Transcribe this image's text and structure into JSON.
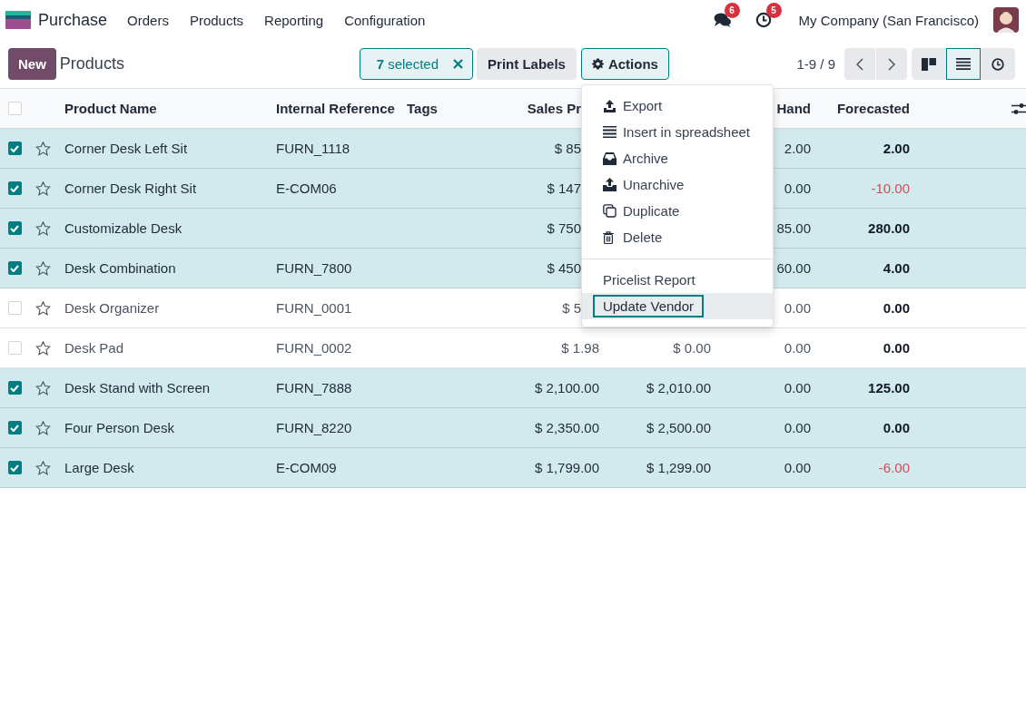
{
  "navbar": {
    "app": "Purchase",
    "menu": [
      "Orders",
      "Products",
      "Reporting",
      "Configuration"
    ],
    "messages_count": "6",
    "activities_count": "5",
    "company": "My Company (San Francisco)"
  },
  "control_panel": {
    "new_button": "New",
    "title": "Products",
    "selection": {
      "count": "7",
      "label": "selected"
    },
    "print_button": "Print Labels",
    "actions_button": "Actions",
    "pager": "1-9 / 9",
    "views": [
      {
        "kind": "kanban",
        "selected": false
      },
      {
        "kind": "list",
        "selected": true
      },
      {
        "kind": "activity",
        "selected": false
      }
    ]
  },
  "actions_menu": {
    "open": true,
    "items": [
      {
        "kind": "export",
        "label": "Export"
      },
      {
        "kind": "spreadsheet",
        "label": "Insert in spreadsheet"
      },
      {
        "kind": "archive",
        "label": "Archive"
      },
      {
        "kind": "unarchive",
        "label": "Unarchive"
      },
      {
        "kind": "duplicate",
        "label": "Duplicate"
      },
      {
        "kind": "delete",
        "label": "Delete"
      }
    ],
    "extra_items": [
      {
        "label": "Pricelist Report",
        "focused": false
      },
      {
        "label": "Update Vendor",
        "focused": true
      }
    ]
  },
  "table": {
    "all_selected": false,
    "columns": {
      "name": "Product Name",
      "reference": "Internal Reference",
      "tags": "Tags",
      "sales_price": "Sales Pr",
      "on_hand": "Hand",
      "forecasted": "Forecasted"
    },
    "rows": [
      {
        "selected": true,
        "name": "Corner Desk Left Sit",
        "reference": "FURN_1118",
        "sales_price": "$ 85",
        "on_hand": "2.00",
        "forecasted": "2.00",
        "negative": false
      },
      {
        "selected": true,
        "name": "Corner Desk Right Sit",
        "reference": "E-COM06",
        "sales_price": "$ 147",
        "on_hand": "0.00",
        "forecasted": "-10.00",
        "negative": true
      },
      {
        "selected": true,
        "name": "Customizable Desk",
        "sales_price": "$ 750",
        "on_hand": "85.00",
        "forecasted": "280.00",
        "negative": false
      },
      {
        "selected": true,
        "name": "Desk Combination",
        "reference": "FURN_7800",
        "sales_price": "$ 450",
        "on_hand": "60.00",
        "forecasted": "4.00",
        "negative": false
      },
      {
        "selected": false,
        "name": "Desk Organizer",
        "reference": "FURN_0001",
        "sales_price": "$ 5",
        "on_hand": "0.00",
        "forecasted": "0.00",
        "negative": false
      },
      {
        "selected": false,
        "name": "Desk Pad",
        "reference": "FURN_0002",
        "sales_price": "$ 1.98",
        "cost": "$ 0.00",
        "on_hand": "0.00",
        "forecasted": "0.00",
        "negative": false
      },
      {
        "selected": true,
        "name": "Desk Stand with Screen",
        "reference": "FURN_7888",
        "sales_price": "$ 2,100.00",
        "cost": "$ 2,010.00",
        "on_hand": "0.00",
        "forecasted": "125.00",
        "negative": false
      },
      {
        "selected": true,
        "name": "Four Person Desk",
        "reference": "FURN_8220",
        "sales_price": "$ 2,350.00",
        "cost": "$ 2,500.00",
        "on_hand": "0.00",
        "forecasted": "0.00",
        "negative": false
      },
      {
        "selected": true,
        "name": "Large Desk",
        "reference": "E-COM09",
        "sales_price": "$ 1,799.00",
        "cost": "$ 1,299.00",
        "on_hand": "0.00",
        "forecasted": "-6.00",
        "negative": true
      }
    ]
  }
}
